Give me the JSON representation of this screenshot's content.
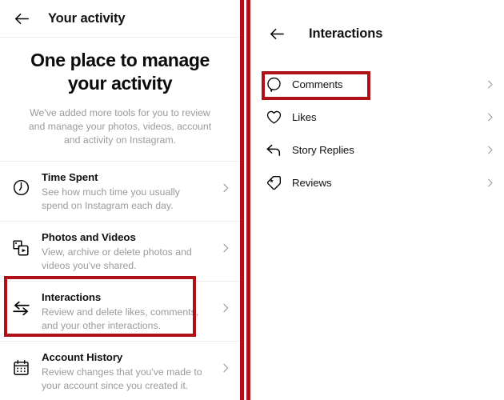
{
  "left_panel": {
    "appbar": {
      "back_icon": "arrow-left-icon",
      "title": "Your activity"
    },
    "hero": {
      "heading": "One place to manage your activity",
      "description": "We've added more tools for you to review and manage your photos, videos, account and activity on Instagram."
    },
    "rows": [
      {
        "icon": "clock-icon",
        "title": "Time Spent",
        "subtitle": "See how much time you usually spend on Instagram each day.",
        "chevron": "chevron-right-icon"
      },
      {
        "icon": "photos-videos-icon",
        "title": "Photos and Videos",
        "subtitle": "View, archive or delete photos and videos you've shared.",
        "chevron": "chevron-right-icon"
      },
      {
        "icon": "interactions-arrows-icon",
        "title": "Interactions",
        "subtitle": "Review and delete likes, comments, and your other interactions.",
        "chevron": "chevron-right-icon",
        "highlighted": true
      },
      {
        "icon": "calendar-icon",
        "title": "Account History",
        "subtitle": "Review changes that you've made to your account since you created it.",
        "chevron": "chevron-right-icon"
      }
    ]
  },
  "right_panel": {
    "appbar": {
      "back_icon": "arrow-left-icon",
      "title": "Interactions"
    },
    "rows": [
      {
        "icon": "comment-bubble-icon",
        "label": "Comments",
        "chevron": "chevron-right-icon",
        "highlighted": true
      },
      {
        "icon": "heart-icon",
        "label": "Likes",
        "chevron": "chevron-right-icon"
      },
      {
        "icon": "reply-arrow-icon",
        "label": "Story Replies",
        "chevron": "chevron-right-icon"
      },
      {
        "icon": "tag-star-icon",
        "label": "Reviews",
        "chevron": "chevron-right-icon"
      }
    ]
  },
  "annotations": {
    "highlight_color": "#b01116",
    "divider_color": "#b01116"
  }
}
